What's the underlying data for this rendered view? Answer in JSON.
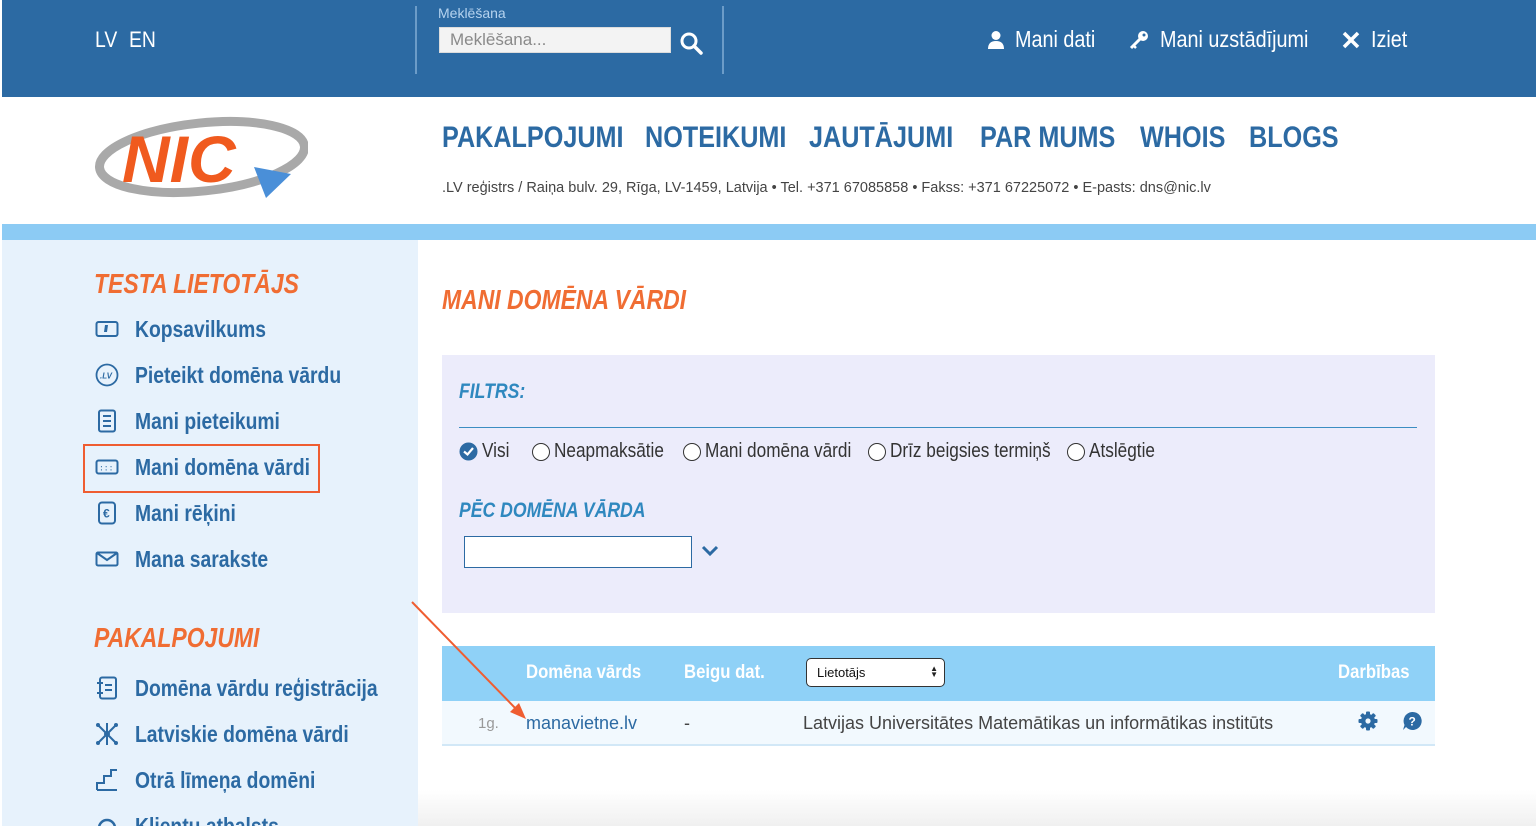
{
  "topbar": {
    "lang": [
      "LV",
      "EN"
    ],
    "search_label": "Meklēšana",
    "search_placeholder": "Meklēšana...",
    "links": [
      "Mani dati",
      "Mani uzstādījumi",
      "Iziet"
    ]
  },
  "header": {
    "logo_text": "NIC",
    "nav": [
      "PAKALPOJUMI",
      "NOTEIKUMI",
      "JAUTĀJUMI",
      "PAR MUMS",
      "WHOIS",
      "BLOGS"
    ],
    "address": ".LV reģistrs / Raiņa bulv. 29, Rīga, LV-1459, Latvija • Tel. +371 67085858 • Fakss: +371 67225072 • E-pasts: dns@nic.lv"
  },
  "sidebar": {
    "user_heading": "TESTA LIETOTĀJS",
    "user_items": [
      "Kopsavilkums",
      "Pieteikt domēna vārdu",
      "Mani pieteikumi",
      "Mani domēna vārdi",
      "Mani rēķini",
      "Mana sarakste"
    ],
    "services_heading": "PAKALPOJUMI",
    "service_items": [
      "Domēna vārdu reģistrācija",
      "Latviskie domēna vārdi",
      "Otrā līmeņa domēni",
      "Klientu atbalsts"
    ]
  },
  "main": {
    "title": "MANI DOMĒNA VĀRDI",
    "filter_heading": "FILTRS:",
    "filters": [
      "Visi",
      "Neapmaksātie",
      "Mani domēna vārdi",
      "Drīz beigsies termiņš",
      "Atslēgtie"
    ],
    "selected_filter": "Visi",
    "by_domain_heading": "PĒC DOMĒNA VĀRDA",
    "table": {
      "headers": [
        "Domēna vārds",
        "Beigu dat.",
        "Darbības"
      ],
      "role_select": "Lietotājs",
      "rows": [
        {
          "period": "1g.",
          "domain": "manavietne.lv",
          "end_date": "-",
          "owner": "Latvijas Universitātes Matemātikas un informātikas institūts"
        }
      ]
    }
  },
  "colors": {
    "topbar": "#2c6aa3",
    "accent_orange": "#f06d33",
    "nav_blue": "#2c6aa3",
    "strip": "#8ccbf4",
    "sidebar_bg": "#e7f2fc",
    "table_head": "#8fd1f7"
  }
}
